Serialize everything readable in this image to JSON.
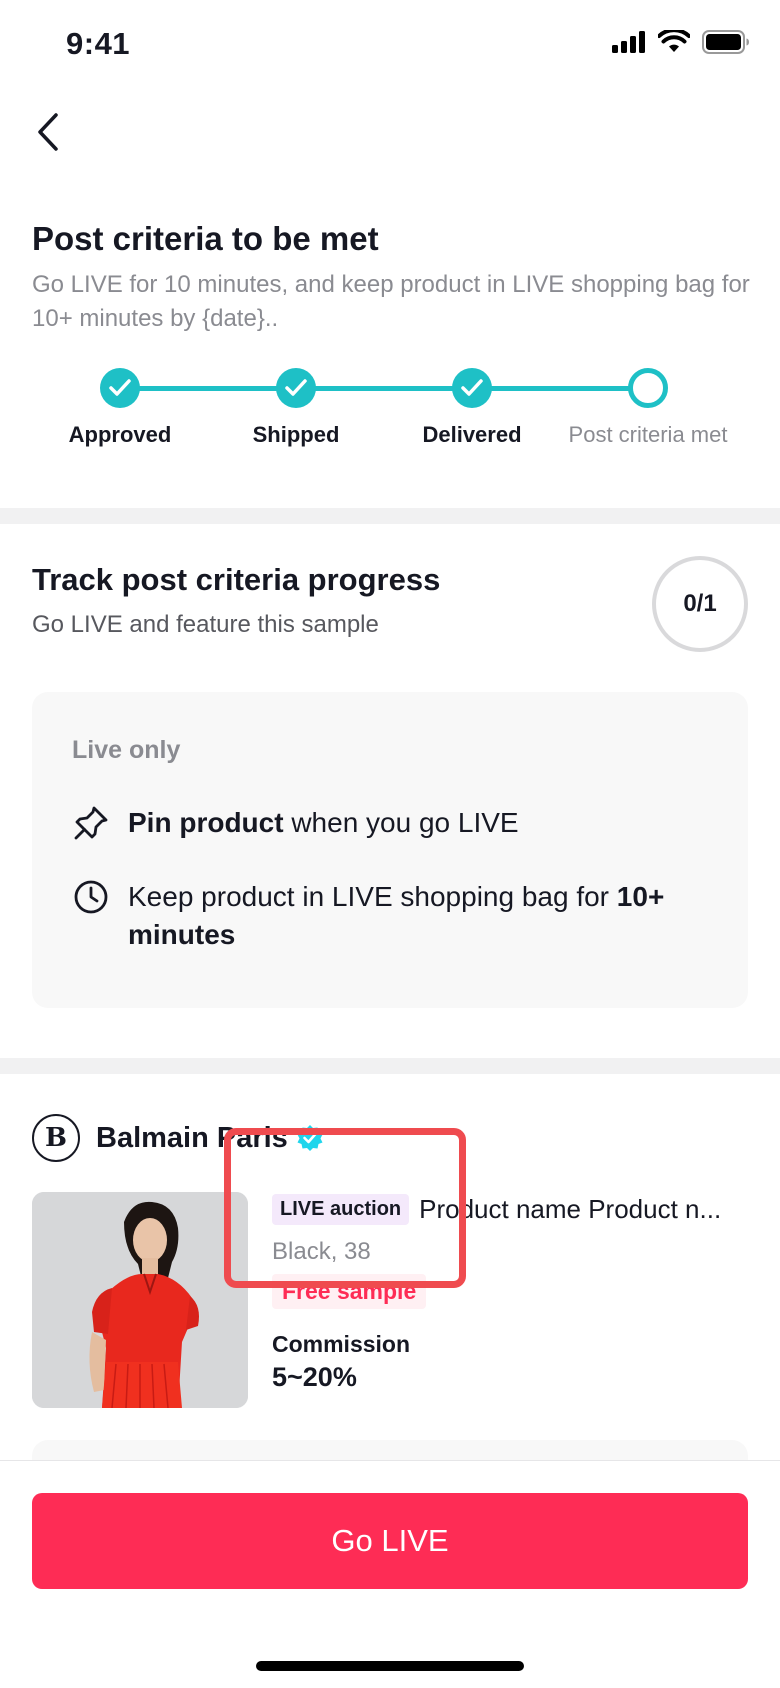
{
  "status_bar": {
    "time": "9:41"
  },
  "criteria": {
    "title": "Post criteria to be met",
    "subtitle": "Go LIVE for 10 minutes, and keep product in LIVE shopping bag for 10+ minutes by {date}..",
    "steps": [
      {
        "label": "Approved",
        "done": true
      },
      {
        "label": "Shipped",
        "done": true
      },
      {
        "label": "Delivered",
        "done": true
      },
      {
        "label": "Post criteria met",
        "done": false
      }
    ]
  },
  "track": {
    "title": "Track post criteria progress",
    "subtitle": "Go LIVE and feature this sample",
    "progress": "0/1",
    "card": {
      "heading": "Live only",
      "req1_bold": "Pin product",
      "req1_rest": " when you go LIVE",
      "req2_text": "Keep product in LIVE shopping bag for ",
      "req2_bold": "10+ minutes"
    }
  },
  "seller": {
    "name": "Balmain Paris",
    "logo_letter": "B"
  },
  "product": {
    "tag": "LIVE auction",
    "name": "Product name Product n...",
    "variant": "Black, 38",
    "sample_tag": "Free sample",
    "commission_label": "Commission",
    "commission_value": "5~20%"
  },
  "cta": {
    "label": "Go LIVE"
  },
  "colors": {
    "accent": "#fe2c55",
    "teal": "#1ec0c6",
    "highlight": "#ef4b4f"
  }
}
